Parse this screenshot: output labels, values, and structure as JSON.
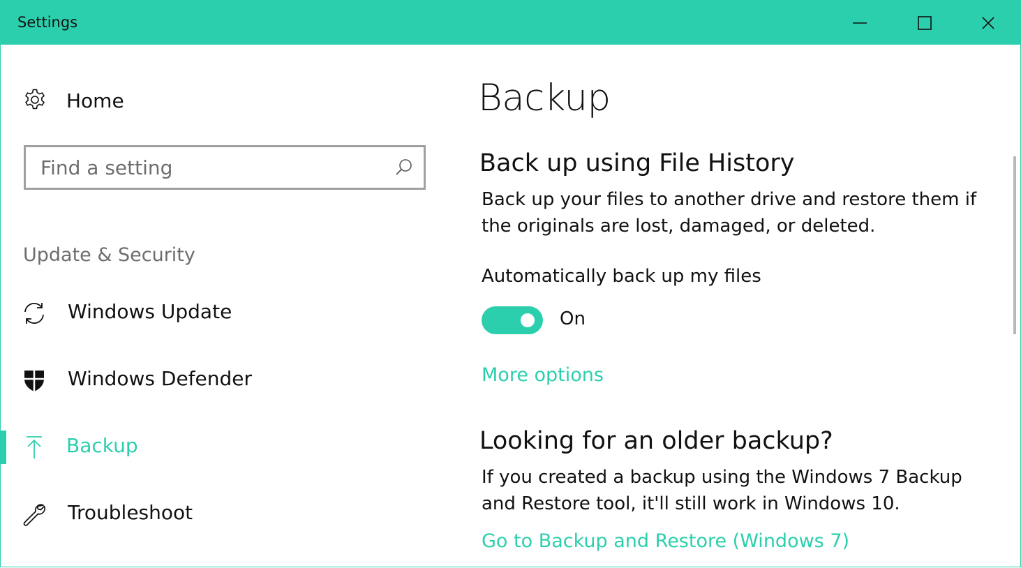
{
  "window": {
    "title": "Settings",
    "accent_color": "#2ccfad",
    "controls": {
      "minimize_icon": "minimize-icon",
      "maximize_icon": "maximize-icon",
      "close_icon": "close-icon"
    }
  },
  "sidebar": {
    "home": {
      "label": "Home",
      "icon": "gear-icon"
    },
    "search": {
      "placeholder": "Find a setting",
      "value": "",
      "icon": "search-icon"
    },
    "section_label": "Update & Security",
    "items": [
      {
        "label": "Windows Update",
        "icon": "sync-icon",
        "selected": false
      },
      {
        "label": "Windows Defender",
        "icon": "shield-icon",
        "selected": false
      },
      {
        "label": "Backup",
        "icon": "upload-arrow-icon",
        "selected": true
      },
      {
        "label": "Troubleshoot",
        "icon": "wrench-icon",
        "selected": false
      }
    ]
  },
  "main": {
    "title": "Backup",
    "file_history": {
      "heading": "Back up using File History",
      "description": "Back up your files to another drive and restore them if the originals are lost, damaged, or deleted.",
      "toggle_label": "Automatically back up my files",
      "toggle_on": true,
      "toggle_state_text": "On",
      "more_options_link": "More options"
    },
    "older_backup": {
      "heading": "Looking for an older backup?",
      "description": "If you created a backup using the Windows 7 Backup and Restore tool, it'll still work in Windows 10.",
      "link": "Go to Backup and Restore (Windows 7)"
    }
  }
}
